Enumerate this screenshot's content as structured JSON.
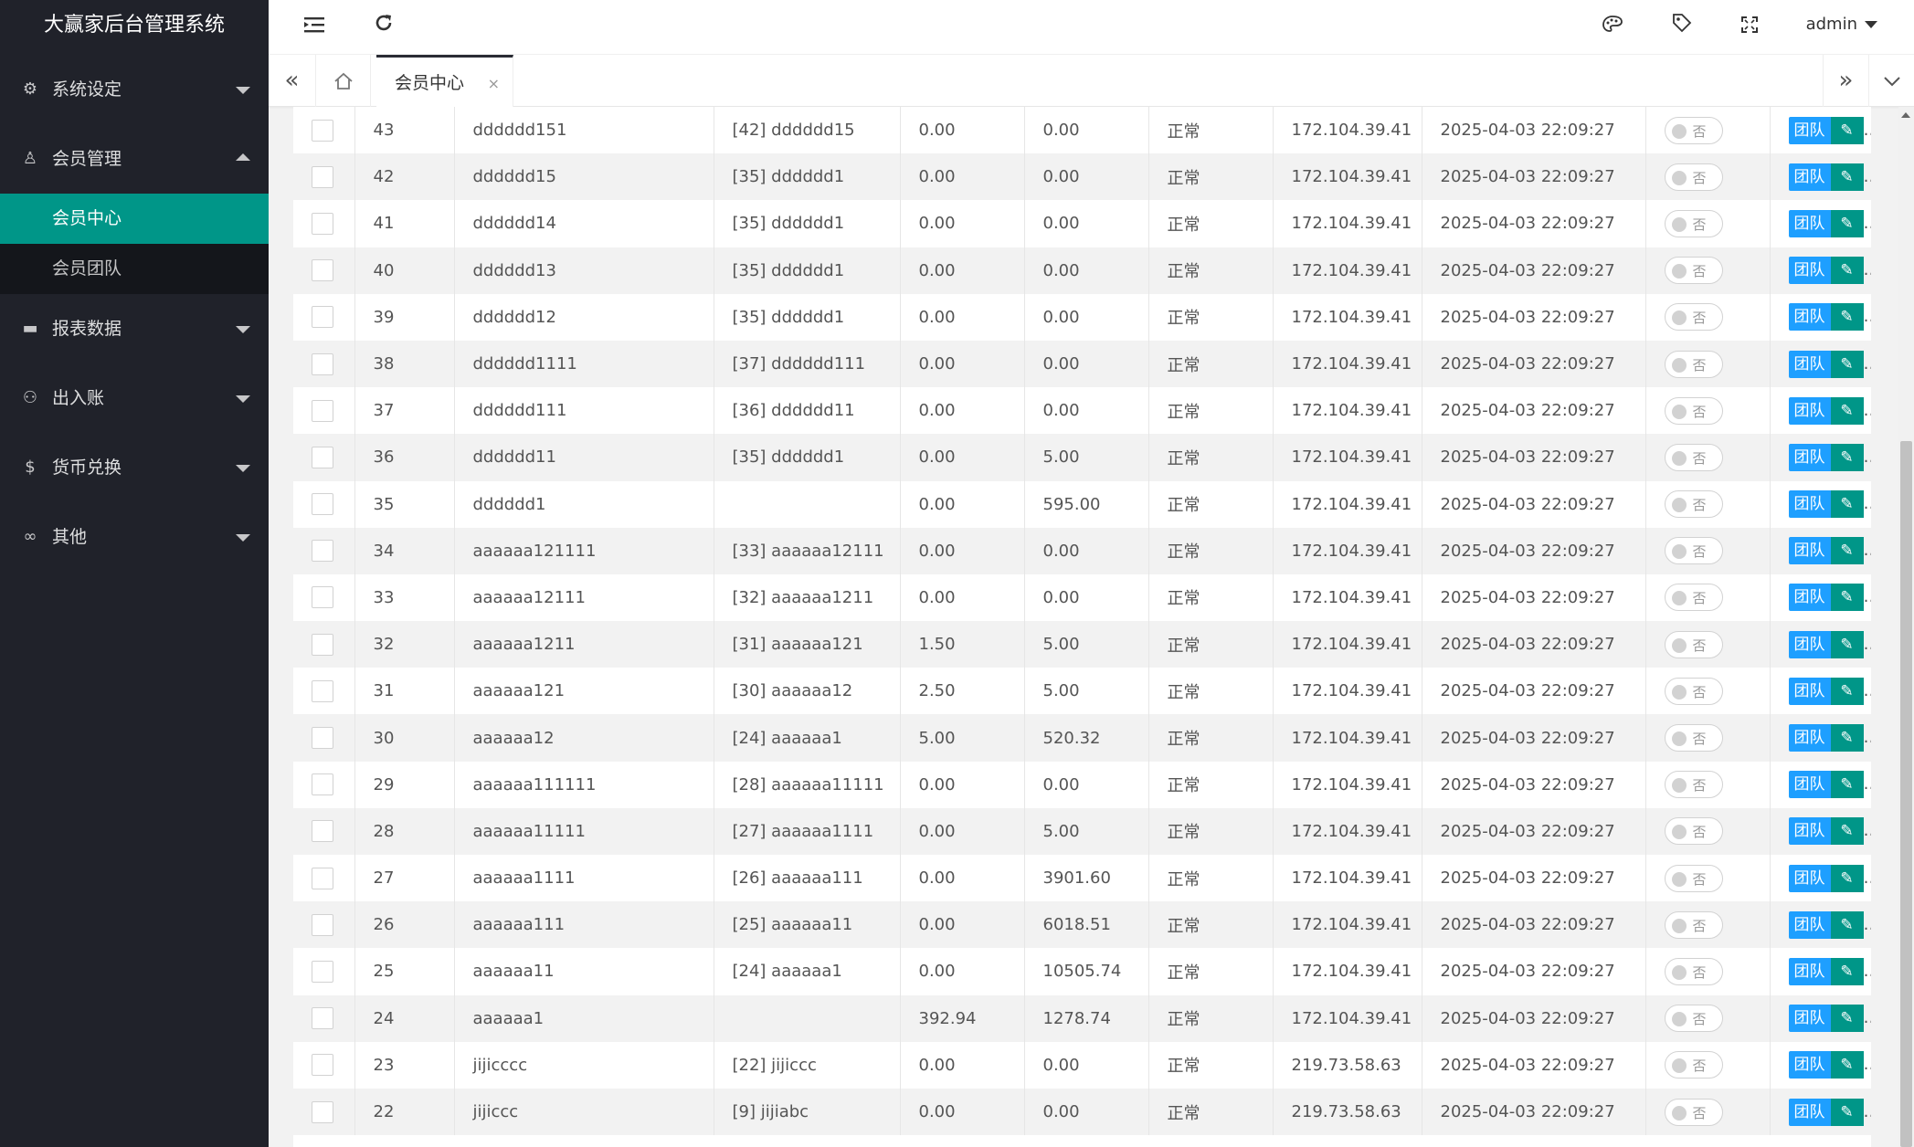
{
  "app": {
    "title": "大赢家后台管理系统"
  },
  "sidebar": {
    "items": [
      {
        "label": "系统设定",
        "icon": "gear-icon",
        "glyph": "⚙",
        "expanded": false
      },
      {
        "label": "会员管理",
        "icon": "user-icon",
        "glyph": "♙",
        "expanded": true
      },
      {
        "label": "报表数据",
        "icon": "monitor-icon",
        "glyph": "▬",
        "expanded": false
      },
      {
        "label": "出入账",
        "icon": "group-icon",
        "glyph": "⚇",
        "expanded": false
      },
      {
        "label": "货币兑换",
        "icon": "dollar-icon",
        "glyph": "$",
        "expanded": false
      },
      {
        "label": "其他",
        "icon": "link-icon",
        "glyph": "∞",
        "expanded": false
      }
    ],
    "submenu": [
      {
        "label": "会员中心",
        "active": true
      },
      {
        "label": "会员团队",
        "active": false
      }
    ]
  },
  "header": {
    "user": "admin",
    "icons": [
      "menu-toggle-icon",
      "refresh-icon",
      "palette-icon",
      "tag-icon",
      "fullscreen-icon"
    ]
  },
  "tabs": {
    "home_icon": "home-icon",
    "active_label": "会员中心",
    "close_glyph": "×"
  },
  "table": {
    "rows": [
      [
        "43",
        "dddddd151",
        "[42] dddddd15",
        "0.00",
        "0.00",
        "正常",
        "172.104.39.41",
        "2025-04-03 22:09:27"
      ],
      [
        "42",
        "dddddd15",
        "[35] dddddd1",
        "0.00",
        "0.00",
        "正常",
        "172.104.39.41",
        "2025-04-03 22:09:27"
      ],
      [
        "41",
        "dddddd14",
        "[35] dddddd1",
        "0.00",
        "0.00",
        "正常",
        "172.104.39.41",
        "2025-04-03 22:09:27"
      ],
      [
        "40",
        "dddddd13",
        "[35] dddddd1",
        "0.00",
        "0.00",
        "正常",
        "172.104.39.41",
        "2025-04-03 22:09:27"
      ],
      [
        "39",
        "dddddd12",
        "[35] dddddd1",
        "0.00",
        "0.00",
        "正常",
        "172.104.39.41",
        "2025-04-03 22:09:27"
      ],
      [
        "38",
        "dddddd1111",
        "[37] dddddd111",
        "0.00",
        "0.00",
        "正常",
        "172.104.39.41",
        "2025-04-03 22:09:27"
      ],
      [
        "37",
        "dddddd111",
        "[36] dddddd11",
        "0.00",
        "0.00",
        "正常",
        "172.104.39.41",
        "2025-04-03 22:09:27"
      ],
      [
        "36",
        "dddddd11",
        "[35] dddddd1",
        "0.00",
        "5.00",
        "正常",
        "172.104.39.41",
        "2025-04-03 22:09:27"
      ],
      [
        "35",
        "dddddd1",
        "",
        "0.00",
        "595.00",
        "正常",
        "172.104.39.41",
        "2025-04-03 22:09:27"
      ],
      [
        "34",
        "aaaaaa121111",
        "[33] aaaaaa12111",
        "0.00",
        "0.00",
        "正常",
        "172.104.39.41",
        "2025-04-03 22:09:27"
      ],
      [
        "33",
        "aaaaaa12111",
        "[32] aaaaaa1211",
        "0.00",
        "0.00",
        "正常",
        "172.104.39.41",
        "2025-04-03 22:09:27"
      ],
      [
        "32",
        "aaaaaa1211",
        "[31] aaaaaa121",
        "1.50",
        "5.00",
        "正常",
        "172.104.39.41",
        "2025-04-03 22:09:27"
      ],
      [
        "31",
        "aaaaaa121",
        "[30] aaaaaa12",
        "2.50",
        "5.00",
        "正常",
        "172.104.39.41",
        "2025-04-03 22:09:27"
      ],
      [
        "30",
        "aaaaaa12",
        "[24] aaaaaa1",
        "5.00",
        "520.32",
        "正常",
        "172.104.39.41",
        "2025-04-03 22:09:27"
      ],
      [
        "29",
        "aaaaaa111111",
        "[28] aaaaaa11111",
        "0.00",
        "0.00",
        "正常",
        "172.104.39.41",
        "2025-04-03 22:09:27"
      ],
      [
        "28",
        "aaaaaa11111",
        "[27] aaaaaa1111",
        "0.00",
        "5.00",
        "正常",
        "172.104.39.41",
        "2025-04-03 22:09:27"
      ],
      [
        "27",
        "aaaaaa1111",
        "[26] aaaaaa111",
        "0.00",
        "3901.60",
        "正常",
        "172.104.39.41",
        "2025-04-03 22:09:27"
      ],
      [
        "26",
        "aaaaaa111",
        "[25] aaaaaa11",
        "0.00",
        "6018.51",
        "正常",
        "172.104.39.41",
        "2025-04-03 22:09:27"
      ],
      [
        "25",
        "aaaaaa11",
        "[24] aaaaaa1",
        "0.00",
        "10505.74",
        "正常",
        "172.104.39.41",
        "2025-04-03 22:09:27"
      ],
      [
        "24",
        "aaaaaa1",
        "",
        "392.94",
        "1278.74",
        "正常",
        "172.104.39.41",
        "2025-04-03 22:09:27"
      ],
      [
        "23",
        "jijicccc",
        "[22] jijiccc",
        "0.00",
        "0.00",
        "正常",
        "219.73.58.63",
        "2025-04-03 22:09:27"
      ],
      [
        "22",
        "jijiccc",
        "[9] jijiabc",
        "0.00",
        "0.00",
        "正常",
        "219.73.58.63",
        "2025-04-03 22:09:27"
      ]
    ],
    "switch_label": "否",
    "team_button": "团队",
    "edit_glyph": "✎",
    "more_glyph": "…"
  },
  "colors": {
    "sidebar_bg": "#20222a",
    "submenu_bg": "#14161b",
    "accent": "#009688",
    "primary_blue": "#1e9fff"
  }
}
